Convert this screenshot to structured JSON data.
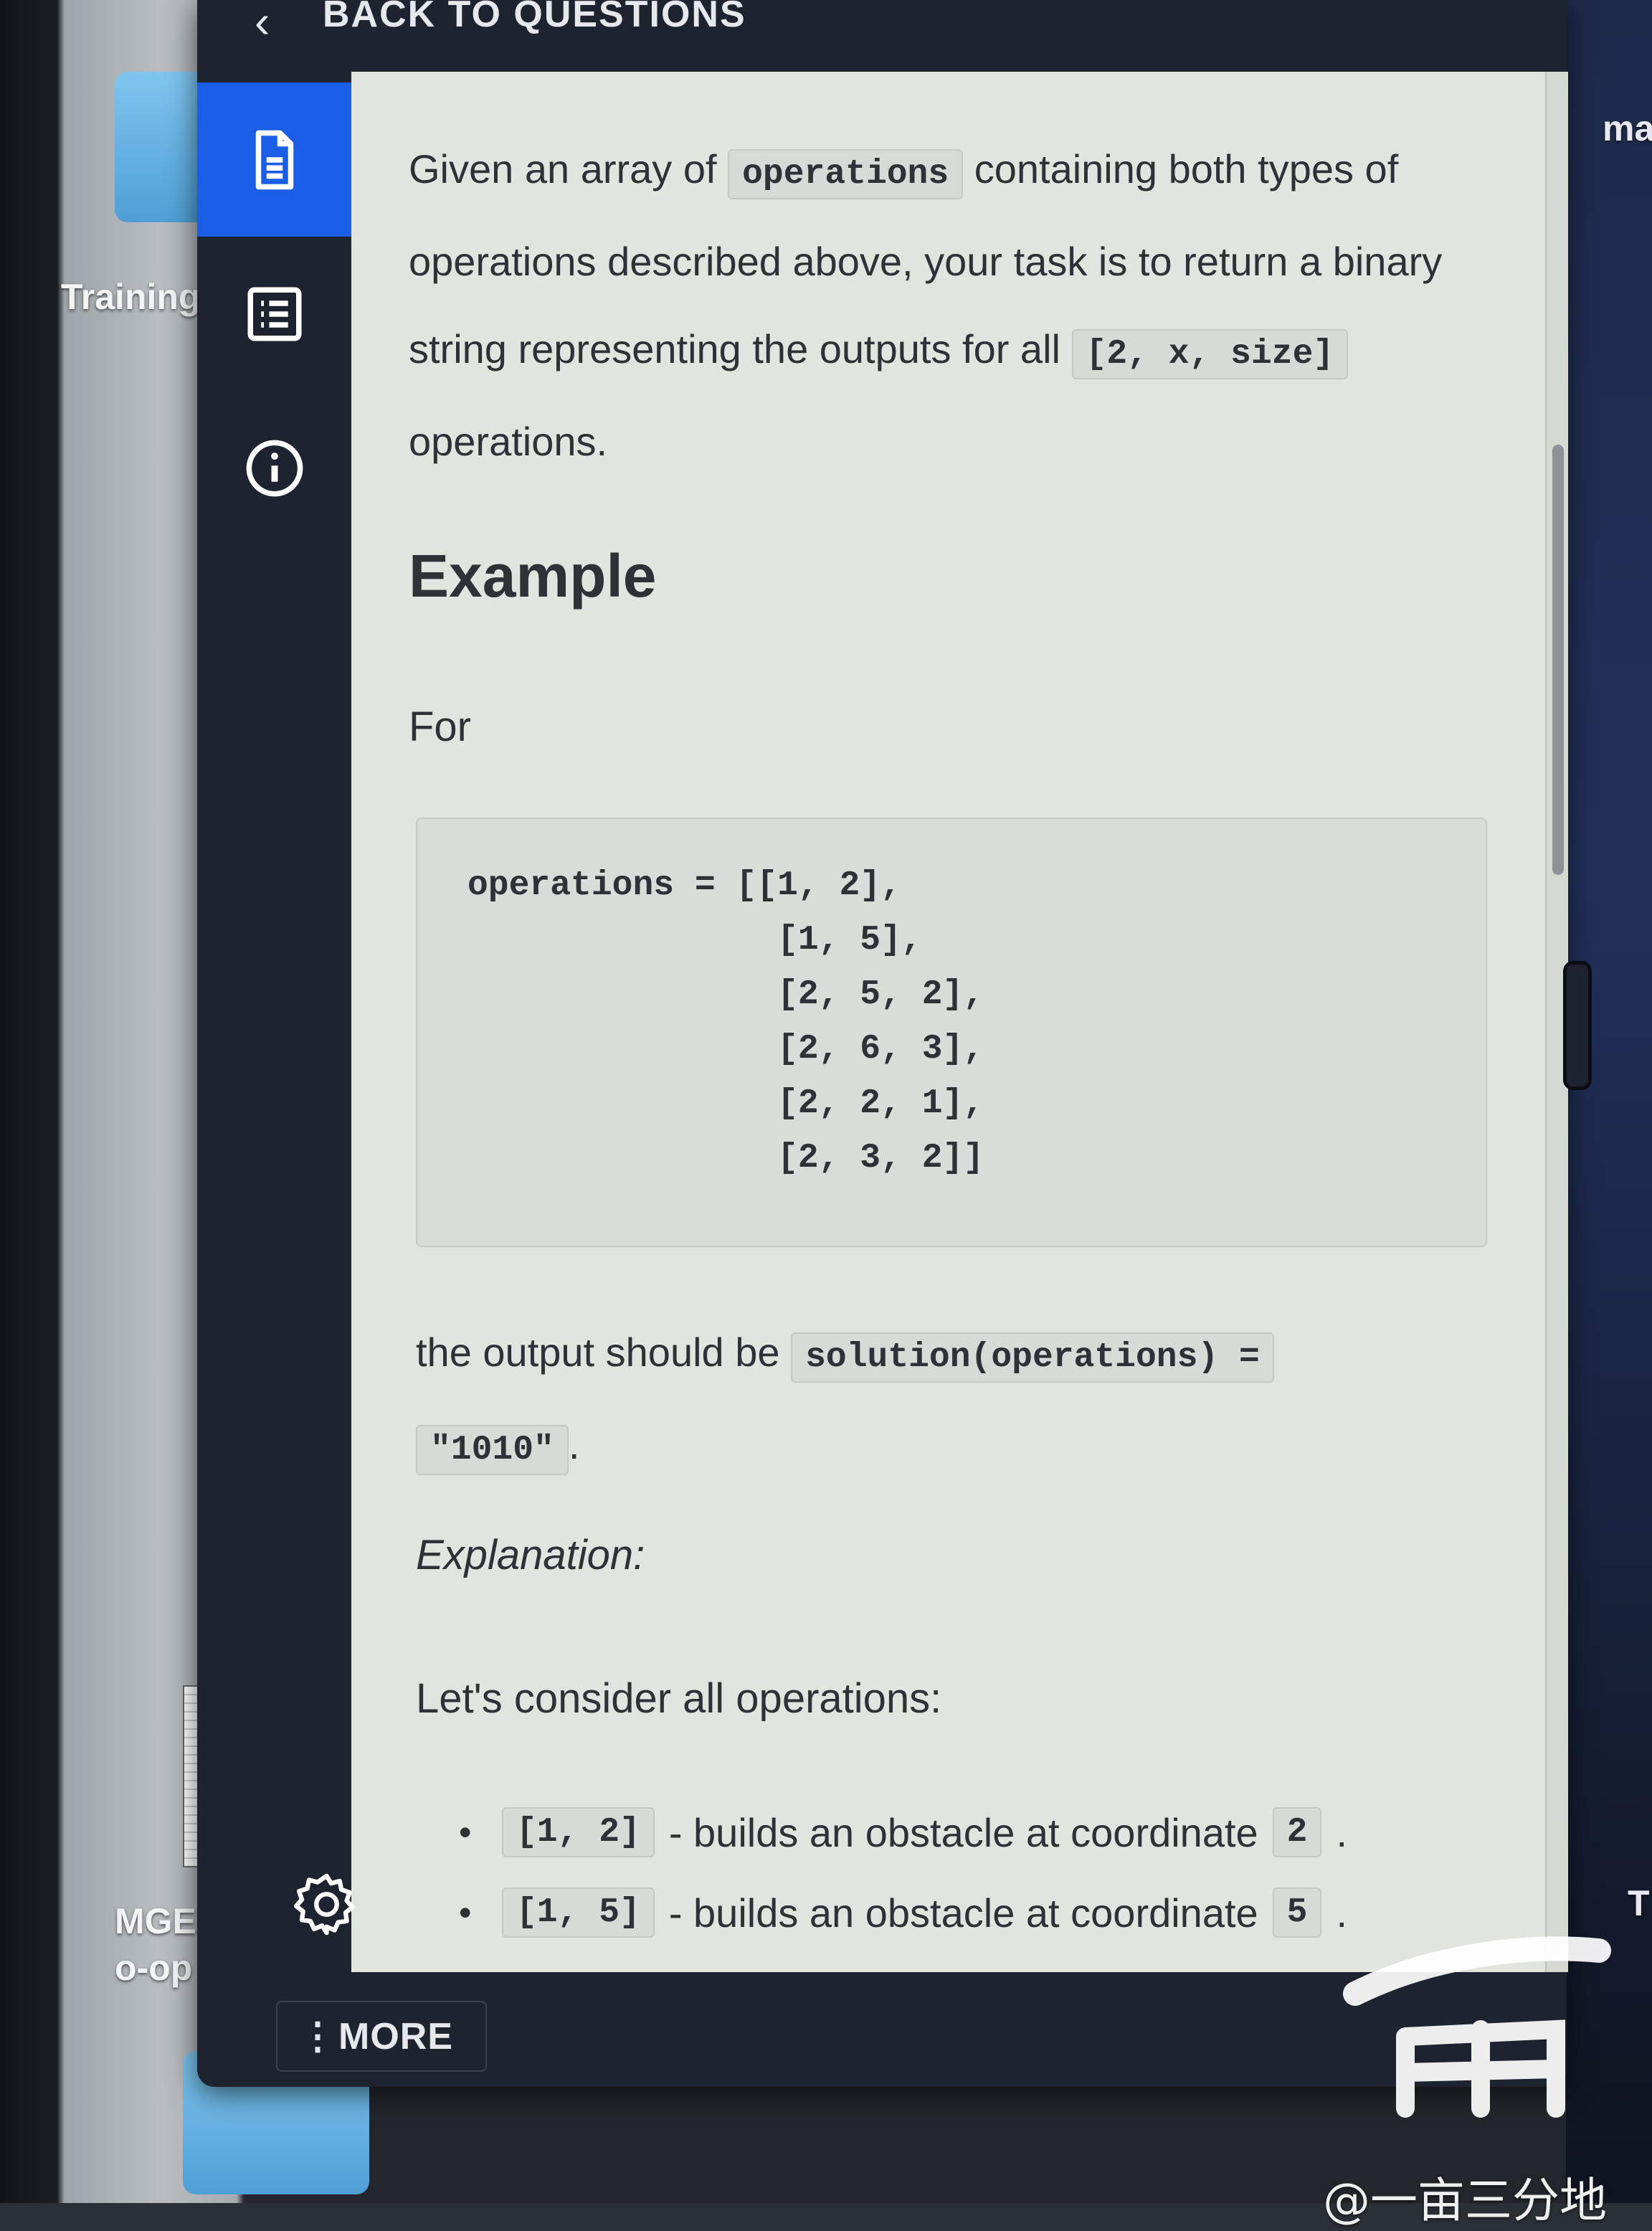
{
  "desktop": {
    "labels": {
      "training": "Training",
      "file_line1": "MGEN C",
      "file_line2": "o-op P..",
      "right_top": "ma",
      "right_mid": "T"
    }
  },
  "header": {
    "back_label": "BACK TO QUESTIONS"
  },
  "sidebar": {
    "icons": [
      "document-icon",
      "list-icon",
      "info-icon",
      "gear-icon"
    ],
    "active_color": "#1b5ee6",
    "more_label": "MORE"
  },
  "content": {
    "intro": {
      "t1": "Given an array of",
      "c1": "operations",
      "t2": "containing both types of operations described above, your task is to return a binary string representing the outputs for all",
      "c2": "[2, x, size]",
      "t3": "operations."
    },
    "example_heading": "Example",
    "for_text": "For",
    "code_block": "operations = [[1, 2],\n               [1, 5],\n               [2, 5, 2],\n               [2, 6, 3],\n               [2, 2, 1],\n               [2, 3, 2]]",
    "output": {
      "t1": "the output should be",
      "c1": "solution(operations) =",
      "c2": "\"1010\"",
      "t2": "."
    },
    "explanation_label": "Explanation:",
    "consider_text": "Let's consider all operations:",
    "bullets": [
      {
        "code": "[1, 2]",
        "text": "- builds an obstacle at coordinate",
        "value": "2",
        "end": "."
      },
      {
        "code": "[1, 5]",
        "text": "- builds an obstacle at coordinate",
        "value": "5",
        "end": "."
      }
    ]
  },
  "watermark": "@一亩三分地"
}
